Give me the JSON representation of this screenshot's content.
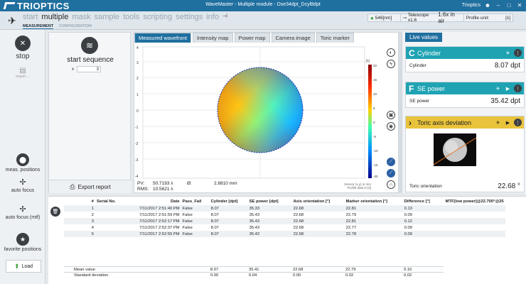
{
  "app": {
    "brand": "TRIOPTICS",
    "window_title": "WaveMaster - Multiple module - Dse34dpt_Dcyl8dpt",
    "user": "Trioptics",
    "menus": [
      "start",
      "multiple",
      "mask",
      "sample",
      "tools",
      "scripting",
      "settings",
      "info"
    ],
    "active_menu": "multiple",
    "submenus": [
      "MEASUREMENT",
      "CONFIGURATION"
    ],
    "active_submenu": "MEASUREMENT"
  },
  "status": {
    "wavelength": "546[nm]",
    "telescope": "Telescope x1.6",
    "magnification": "1.6x in air",
    "profile_label": "Profile unit:",
    "profile_value": "[λ]"
  },
  "left_rail": {
    "stop": "stop",
    "export_small": "export ...",
    "meas_positions": "meas. positions",
    "auto_focus": "auto focus",
    "auto_focus_mtf": "auto focus (mtf)",
    "favorite_positions": "favorite positions",
    "load": "Load"
  },
  "sequence": {
    "title": "start sequence",
    "count_prefix": "x",
    "count": "3",
    "export_report": "Export report"
  },
  "wavefront": {
    "tabs": [
      "Measured wavefront",
      "Intensity map",
      "Power map",
      "Camera image",
      "Toric marker"
    ],
    "active_tab": "Measured wavefront",
    "y_ticks": [
      "4",
      "3",
      "2",
      "1",
      "0",
      "-1",
      "-2",
      "-3",
      "-4"
    ],
    "colorbar_ticks": [
      "20",
      "15",
      "10",
      "5",
      "0",
      "-5",
      "-10",
      "-15",
      "-20"
    ],
    "colorbar_unit": "[λ]",
    "pv_label": "PV:",
    "pv_value": "50.7193 λ",
    "rms_label": "RMS:",
    "rms_value": "10.5621 λ",
    "diameter_label": "Ø:",
    "diameter_value": "2.8810 mm",
    "sensor_note_1": "Sensor (x,y) in mm",
    "sensor_note_2": "Profile data in [λ]"
  },
  "live_values": {
    "tab": "Live values",
    "cards": [
      {
        "letter": "C",
        "title": "Cylinder",
        "label": "Cylinder",
        "value": "8.07 dpt",
        "color": "#1fa3b3"
      },
      {
        "letter": "F",
        "title": "SE power",
        "label": "SE power",
        "value": "35.42 dpt",
        "color": "#1fa3b3"
      },
      {
        "letter": "",
        "title": "Toric axis deviation",
        "label": "Toric orientation",
        "value": "22.68 °",
        "color": "#e9c33b"
      }
    ]
  },
  "table": {
    "columns": [
      "#",
      "Serial No.",
      "Date",
      "Pass_Fail",
      "Cylinder [dpt]",
      "SE power [dpt]",
      "Axis orientation [°]",
      "Marker orientation [°]",
      "Difference [°]",
      "MTF[low power]@22.700°@25"
    ],
    "rows": [
      [
        "1",
        "",
        "7/11/2017 2:51:40 PM",
        "False",
        "8.07",
        "35.33",
        "22.68",
        "22.81",
        "0.13",
        ""
      ],
      [
        "2",
        "",
        "7/11/2017 2:51:59 PM",
        "False",
        "8.07",
        "35.43",
        "22.68",
        "22.79",
        "0.09",
        ""
      ],
      [
        "3",
        "",
        "7/11/2017 2:52:17 PM",
        "False",
        "8.07",
        "35.43",
        "22.68",
        "22.81",
        "0.12",
        ""
      ],
      [
        "4",
        "",
        "7/11/2017 2:52:37 PM",
        "False",
        "8.07",
        "35.43",
        "22.68",
        "22.77",
        "0.09",
        ""
      ],
      [
        "5",
        "",
        "7/11/2017 2:52:55 PM",
        "False",
        "8.07",
        "35.42",
        "22.68",
        "22.78",
        "0.09",
        ""
      ]
    ],
    "stats": [
      [
        "Mean value",
        "8.07",
        "35.41",
        "22.68",
        "22.79",
        "0.10"
      ],
      [
        "Standard deviation",
        "0.00",
        "0.04",
        "0.00",
        "0.02",
        "0.02"
      ]
    ]
  }
}
